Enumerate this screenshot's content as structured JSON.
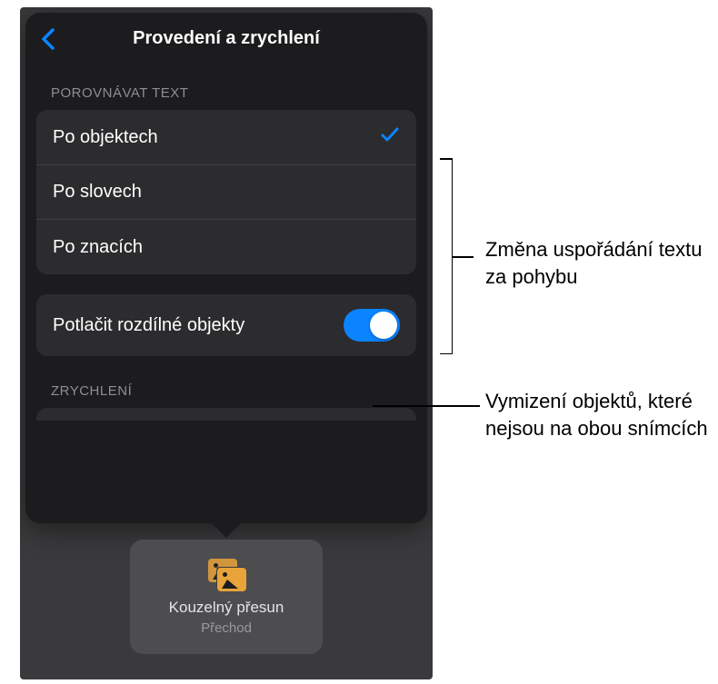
{
  "popover": {
    "title": "Provedení a zrychlení",
    "section_match": "Porovnávat text",
    "options": {
      "by_objects": "Po objektech",
      "by_words": "Po slovech",
      "by_chars": "Po znacích"
    },
    "fade_row": "Potlačit rozdílné objekty",
    "section_accel": "Zrychlení"
  },
  "thumbnail": {
    "title": "Kouzelný přesun",
    "subtitle": "Přechod"
  },
  "callouts": {
    "text_match": "Změna uspořádání textu za pohybu",
    "fade": "Vymizení objektů, které nejsou na obou snímcích"
  }
}
